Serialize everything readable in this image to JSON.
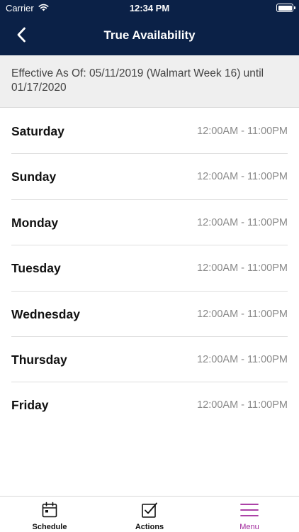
{
  "status_bar": {
    "carrier": "Carrier",
    "time": "12:34 PM"
  },
  "nav": {
    "title": "True Availability"
  },
  "effective": {
    "text": "Effective As Of: 05/11/2019 (Walmart Week 16) until 01/17/2020"
  },
  "days": [
    {
      "name": "Saturday",
      "hours": "12:00AM - 11:00PM"
    },
    {
      "name": "Sunday",
      "hours": "12:00AM - 11:00PM"
    },
    {
      "name": "Monday",
      "hours": "12:00AM - 11:00PM"
    },
    {
      "name": "Tuesday",
      "hours": "12:00AM - 11:00PM"
    },
    {
      "name": "Wednesday",
      "hours": "12:00AM - 11:00PM"
    },
    {
      "name": "Thursday",
      "hours": "12:00AM - 11:00PM"
    },
    {
      "name": "Friday",
      "hours": "12:00AM - 11:00PM"
    }
  ],
  "tabs": [
    {
      "label": "Schedule",
      "icon": "calendar-icon",
      "active": false
    },
    {
      "label": "Actions",
      "icon": "checkbox-icon",
      "active": false
    },
    {
      "label": "Menu",
      "icon": "hamburger-menu-icon",
      "active": true
    }
  ],
  "colors": {
    "header": "#0b2147",
    "active_tab": "#a0279b",
    "hours_text": "#8a8a8a"
  }
}
